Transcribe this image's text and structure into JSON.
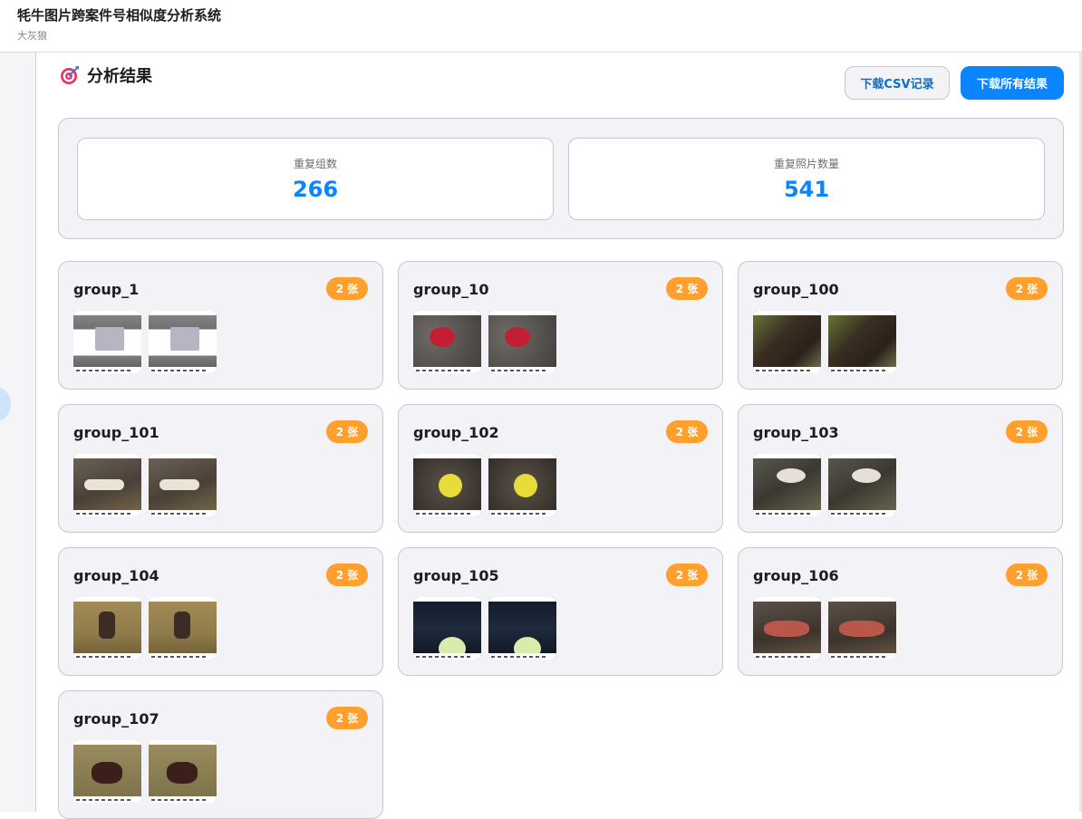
{
  "header": {
    "title": "牦牛图片跨案件号相似度分析系统",
    "user": "大灰狼"
  },
  "section": {
    "title": "分析结果",
    "icon": "target-icon"
  },
  "buttons": {
    "csv": "下载CSV记录",
    "all": "下载所有结果"
  },
  "stats": [
    {
      "label": "重复组数",
      "value": "266"
    },
    {
      "label": "重复照片数量",
      "value": "541"
    }
  ],
  "colors": {
    "accent": "#0a84ff",
    "badge": "#ff9f2e",
    "panel": "#f2f2f7"
  },
  "groups": [
    {
      "name": "group_1",
      "badge": "2 张",
      "thumb_style": "document-photo"
    },
    {
      "name": "group_10",
      "badge": "2 张",
      "thumb_style": "gravel-red-wound"
    },
    {
      "name": "group_100",
      "badge": "2 张",
      "thumb_style": "dark-hide-grass"
    },
    {
      "name": "group_101",
      "badge": "2 张",
      "thumb_style": "yak-jaw-teeth"
    },
    {
      "name": "group_102",
      "badge": "2 张",
      "thumb_style": "yellow-ear-tag"
    },
    {
      "name": "group_103",
      "badge": "2 张",
      "thumb_style": "yak-horn-ground"
    },
    {
      "name": "group_104",
      "badge": "2 张",
      "thumb_style": "person-on-grass"
    },
    {
      "name": "group_105",
      "badge": "2 张",
      "thumb_style": "green-ear-tag-dark"
    },
    {
      "name": "group_106",
      "badge": "2 张",
      "thumb_style": "yak-mouth-open"
    },
    {
      "name": "group_107",
      "badge": "2 张",
      "thumb_style": "carcass-on-grass"
    }
  ]
}
